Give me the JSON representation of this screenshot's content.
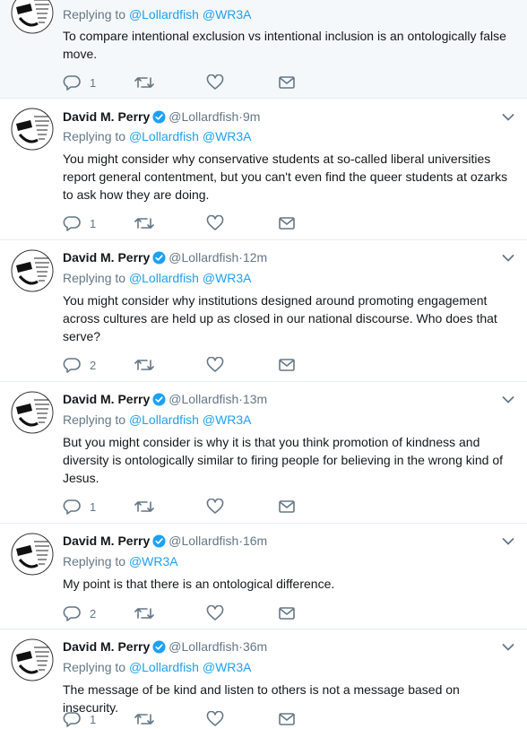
{
  "colors": {
    "link": "#1da1f2",
    "muted": "#657786",
    "verified": "#1da1f2"
  },
  "tweets": [
    {
      "name": "",
      "handle": "",
      "time": "",
      "replying_prefix": "Replying to",
      "mentions": [
        "@Lollardfish",
        "@WR3A"
      ],
      "text": "To compare intentional exclusion vs intentional inclusion is an ontologically false move.",
      "reply_count": "1"
    },
    {
      "name": "David M. Perry",
      "handle": "@Lollardfish",
      "time": "·9m",
      "replying_prefix": "Replying to",
      "mentions": [
        "@Lollardfish",
        "@WR3A"
      ],
      "text": "You might consider why conservative students at so-called liberal universities report general contentment, but you can't even find the queer students at ozarks to ask how they are doing.",
      "reply_count": "1"
    },
    {
      "name": "David M. Perry",
      "handle": "@Lollardfish",
      "time": "·12m",
      "replying_prefix": "Replying to",
      "mentions": [
        "@Lollardfish",
        "@WR3A"
      ],
      "text": "You might consider why institutions designed around promoting engagement across cultures are held up as closed in our national discourse. Who does that serve?",
      "reply_count": "2"
    },
    {
      "name": "David M. Perry",
      "handle": "@Lollardfish",
      "time": "·13m",
      "replying_prefix": "Replying to",
      "mentions": [
        "@Lollardfish",
        "@WR3A"
      ],
      "text": "But you might consider is why it is that you think promotion of kindness and diversity is ontologically similar to firing people for believing in the wrong kind of Jesus.",
      "reply_count": "1"
    },
    {
      "name": "David M. Perry",
      "handle": "@Lollardfish",
      "time": "·16m",
      "replying_prefix": "Replying to",
      "mentions": [
        "@WR3A"
      ],
      "text": "My point is that there is an ontological difference.",
      "reply_count": "2"
    },
    {
      "name": "David M. Perry",
      "handle": "@Lollardfish",
      "time": "·36m",
      "replying_prefix": "Replying to",
      "mentions": [
        "@Lollardfish",
        "@WR3A"
      ],
      "text": "The message of be kind and listen to others is not a message based on insecurity.",
      "reply_count": "1"
    }
  ],
  "icons": {
    "reply": "reply-icon",
    "retweet": "retweet-icon",
    "like": "heart-icon",
    "dm": "envelope-icon",
    "menu": "chevron-down-icon",
    "verified": "verified-badge-icon"
  }
}
